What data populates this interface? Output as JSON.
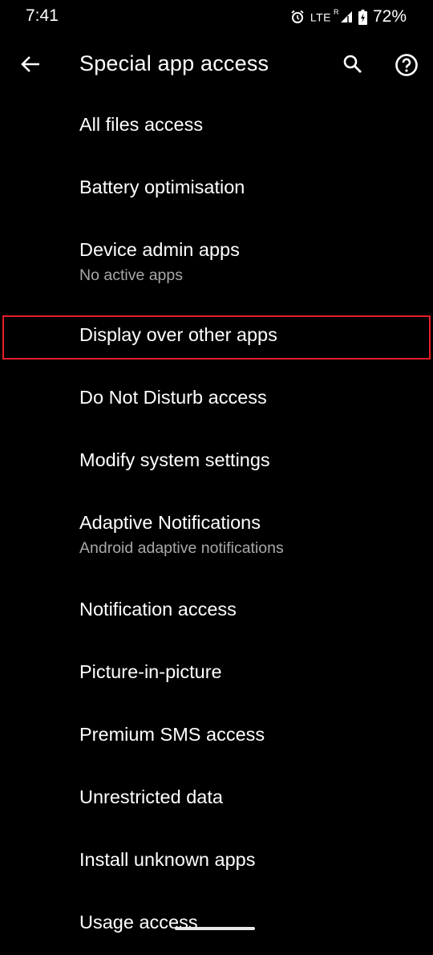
{
  "status_bar": {
    "time": "7:41",
    "icons": [
      "alarm-icon",
      "lte-icon",
      "signal-icon",
      "battery-charging-icon"
    ],
    "network": "LTE",
    "roaming": "R",
    "battery_percent": "72%"
  },
  "app_bar": {
    "back_icon": "arrow-left-icon",
    "title": "Special app access",
    "search_icon": "search-icon",
    "help_icon": "help-circle-icon"
  },
  "items": [
    {
      "title": "All files access",
      "subtitle": ""
    },
    {
      "title": "Battery optimisation",
      "subtitle": ""
    },
    {
      "title": "Device admin apps",
      "subtitle": "No active apps"
    },
    {
      "title": "Display over other apps",
      "subtitle": "",
      "highlighted": true
    },
    {
      "title": "Do Not Disturb access",
      "subtitle": ""
    },
    {
      "title": "Modify system settings",
      "subtitle": ""
    },
    {
      "title": "Adaptive Notifications",
      "subtitle": "Android adaptive notifications"
    },
    {
      "title": "Notification access",
      "subtitle": ""
    },
    {
      "title": "Picture-in-picture",
      "subtitle": ""
    },
    {
      "title": "Premium SMS access",
      "subtitle": ""
    },
    {
      "title": "Unrestricted data",
      "subtitle": ""
    },
    {
      "title": "Install unknown apps",
      "subtitle": ""
    },
    {
      "title": "Usage access",
      "subtitle": ""
    }
  ],
  "colors": {
    "background": "#000000",
    "text_primary": "#ffffff",
    "text_secondary": "#a8a8a8",
    "highlight_border": "#e41e26"
  }
}
